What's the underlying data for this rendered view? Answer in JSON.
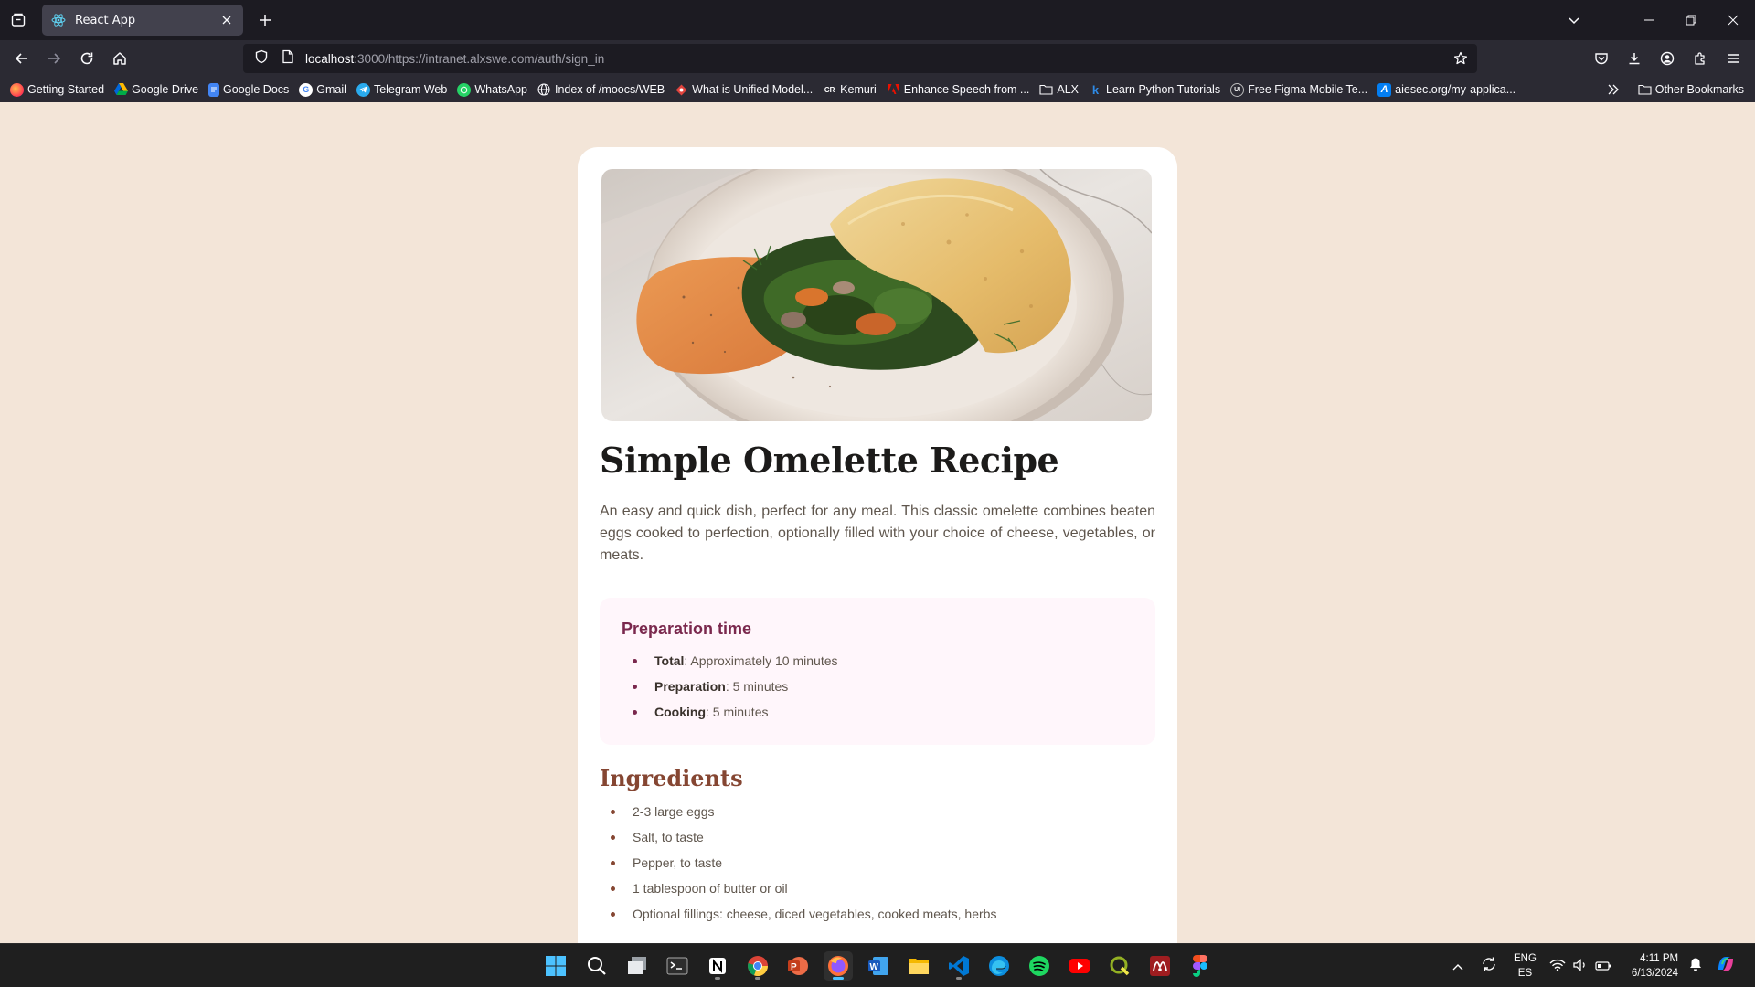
{
  "browser": {
    "tab": {
      "title": "React App"
    },
    "url": {
      "host": "localhost",
      "rest": ":3000/https://intranet.alxswe.com/auth/sign_in"
    },
    "bookmarks": [
      {
        "label": "Getting Started",
        "icon": "firefox-icon",
        "color": "#ff7139"
      },
      {
        "label": "Google Drive",
        "icon": "google-drive-icon",
        "color": "#1fa463"
      },
      {
        "label": "Google Docs",
        "icon": "google-docs-icon",
        "color": "#4285f4"
      },
      {
        "label": "Gmail",
        "icon": "google-icon",
        "color": "#ffffff"
      },
      {
        "label": "Telegram Web",
        "icon": "telegram-icon",
        "color": "#2aabee"
      },
      {
        "label": "WhatsApp",
        "icon": "whatsapp-icon",
        "color": "#25d366"
      },
      {
        "label": "Index of /moocs/WEB",
        "icon": "globe-icon",
        "color": "#2b2a33"
      },
      {
        "label": "What is Unified Model...",
        "icon": "diamond-icon",
        "color": "#e0433d"
      },
      {
        "label": "Kemuri",
        "icon": "cr-icon",
        "color": "#2b2a33"
      },
      {
        "label": "Enhance Speech from ...",
        "icon": "adobe-icon",
        "color": "#eb1000"
      },
      {
        "label": "ALX",
        "icon": "folder-icon",
        "color": "#2b2a33"
      },
      {
        "label": "Learn Python Tutorials",
        "icon": "k-icon",
        "color": "#2b2a33"
      },
      {
        "label": "Free Figma Mobile Te...",
        "icon": "ui-icon",
        "color": "#2b2a33"
      },
      {
        "label": "aiesec.org/my-applica...",
        "icon": "a-icon",
        "color": "#037ef3"
      }
    ],
    "other_bookmarks": "Other Bookmarks"
  },
  "recipe": {
    "title": "Simple Omelette Recipe",
    "description": "An easy and quick dish, perfect for any meal. This classic omelette combines beaten eggs cooked to perfection, optionally filled with your choice of cheese, vegetables, or meats.",
    "preparation": {
      "heading": "Preparation time",
      "items": [
        {
          "label": "Total",
          "value": ": Approximately 10 minutes"
        },
        {
          "label": "Preparation",
          "value": ": 5 minutes"
        },
        {
          "label": "Cooking",
          "value": ": 5 minutes"
        }
      ]
    },
    "ingredients": {
      "heading": "Ingredients",
      "items": [
        "2-3 large eggs",
        "Salt, to taste",
        "Pepper, to taste",
        "1 tablespoon of butter or oil",
        "Optional fillings: cheese, diced vegetables, cooked meats, herbs"
      ]
    }
  },
  "taskbar": {
    "apps": [
      "start-icon",
      "search-icon",
      "task-view-icon",
      "terminal-icon",
      "notion-icon",
      "chrome-icon",
      "powerpoint-icon",
      "firefox-icon",
      "word-icon",
      "file-explorer-icon",
      "vscode-icon",
      "edge-icon",
      "spotify-icon",
      "youtube-icon",
      "qgis-icon",
      "mendeley-icon",
      "figma-icon"
    ],
    "language": {
      "top": "ENG",
      "bottom": "ES"
    },
    "clock": {
      "time": "4:11 PM",
      "date": "6/13/2024"
    }
  },
  "colors": {
    "page_bg": "#f3e5d8",
    "card_bg": "#ffffff",
    "prep_bg": "#fff6fb",
    "prep_accent": "#7a284d",
    "ingredients_accent": "#854632",
    "browser_chrome": "#2b2a33"
  }
}
